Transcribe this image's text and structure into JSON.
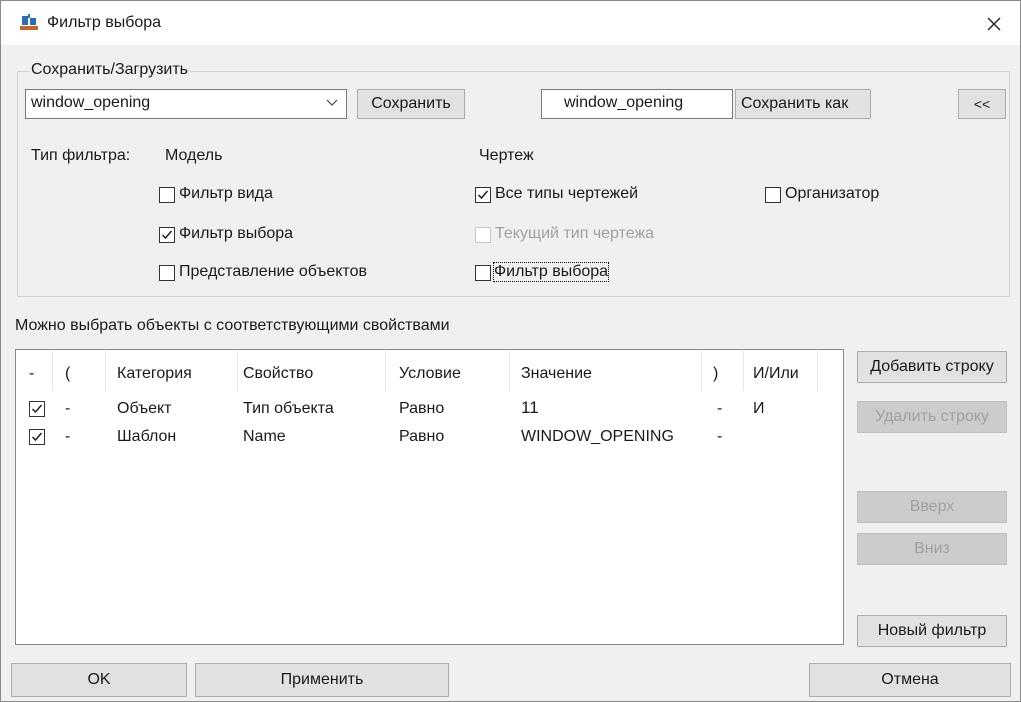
{
  "window": {
    "title": "Фильтр выбора"
  },
  "save_load": {
    "group_title": "Сохранить/Загрузить",
    "preset_value": "window_opening",
    "save_label": "Сохранить",
    "name_value": "window_opening",
    "save_as_label": "Сохранить как",
    "collapse_label": "<<"
  },
  "filter_type": {
    "label": "Тип фильтра:",
    "model_header": "Модель",
    "drawing_header": "Чертеж",
    "view_filter": {
      "label": "Фильтр вида",
      "checked": false
    },
    "selection_filter": {
      "label": "Фильтр выбора",
      "checked": true
    },
    "object_representation": {
      "label": "Представление объектов",
      "checked": false
    },
    "all_drawing_types": {
      "label": "Все типы чертежей",
      "checked": true
    },
    "current_drawing_type": {
      "label": "Текущий тип чертежа",
      "checked": false
    },
    "drawing_selection_filter": {
      "label": "Фильтр выбора",
      "checked": false
    },
    "organizer": {
      "label": "Организатор",
      "checked": false
    }
  },
  "rules": {
    "caption": "Можно выбрать объекты с соответствующими свойствами",
    "columns": [
      "-",
      "(",
      "Категория",
      "Свойство",
      "Условие",
      "Значение",
      ")",
      "И/Или"
    ],
    "rows": [
      {
        "checked": true,
        "open": "-",
        "category": "Объект",
        "property": "Тип объекта",
        "condition": "Равно",
        "value": "11",
        "close": "-",
        "andor": "И"
      },
      {
        "checked": true,
        "open": "-",
        "category": "Шаблон",
        "property": "Name",
        "condition": "Равно",
        "value": "WINDOW_OPENING",
        "close": "-",
        "andor": ""
      }
    ]
  },
  "side_buttons": {
    "add_row": "Добавить строку",
    "delete_row": "Удалить строку",
    "up": "Вверх",
    "down": "Вниз",
    "new_filter": "Новый фильтр"
  },
  "footer": {
    "ok": "OK",
    "apply": "Применить",
    "cancel": "Отмена"
  }
}
